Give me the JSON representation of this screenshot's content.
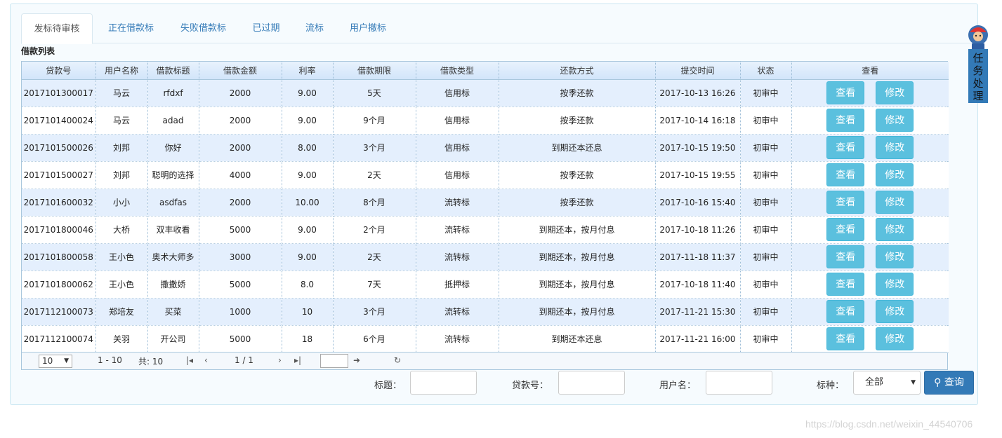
{
  "tabs": [
    {
      "label": "发标待审核",
      "active": true
    },
    {
      "label": "正在借款标"
    },
    {
      "label": "失败借款标"
    },
    {
      "label": "已过期"
    },
    {
      "label": "流标"
    },
    {
      "label": "用户撤标"
    }
  ],
  "list_title": "借款列表",
  "columns": [
    "贷款号",
    "用户名称",
    "借款标题",
    "借款金额",
    "利率",
    "借款期限",
    "借款类型",
    "还款方式",
    "提交时间",
    "状态",
    "查看"
  ],
  "rows": [
    [
      "2017101300017",
      "马云",
      "rfdxf",
      "2000",
      "9.00",
      "5天",
      "信用标",
      "按季还款",
      "2017-10-13 16:26",
      "初审中"
    ],
    [
      "2017101400024",
      "马云",
      "adad",
      "2000",
      "9.00",
      "9个月",
      "信用标",
      "按季还款",
      "2017-10-14 16:18",
      "初审中"
    ],
    [
      "2017101500026",
      "刘邦",
      "你好",
      "2000",
      "8.00",
      "3个月",
      "信用标",
      "到期还本还息",
      "2017-10-15 19:50",
      "初审中"
    ],
    [
      "2017101500027",
      "刘邦",
      "聪明的选择",
      "4000",
      "9.00",
      "2天",
      "信用标",
      "按季还款",
      "2017-10-15 19:55",
      "初审中"
    ],
    [
      "2017101600032",
      "小小",
      "asdfas",
      "2000",
      "10.00",
      "8个月",
      "流转标",
      "按季还款",
      "2017-10-16 15:40",
      "初审中"
    ],
    [
      "2017101800046",
      "大桥",
      "双丰收看",
      "5000",
      "9.00",
      "2个月",
      "流转标",
      "到期还本，按月付息",
      "2017-10-18 11:26",
      "初审中"
    ],
    [
      "2017101800058",
      "王小色",
      "奥术大师多",
      "3000",
      "9.00",
      "2天",
      "流转标",
      "到期还本，按月付息",
      "2017-11-18 11:37",
      "初审中"
    ],
    [
      "2017101800062",
      "王小色",
      "撒撒娇",
      "5000",
      "8.0",
      "7天",
      "抵押标",
      "到期还本，按月付息",
      "2017-10-18 11:40",
      "初审中"
    ],
    [
      "2017112100073",
      "郑培友",
      "买菜",
      "1000",
      "10",
      "3个月",
      "流转标",
      "到期还本，按月付息",
      "2017-11-21 15:30",
      "初审中"
    ],
    [
      "2017112100074",
      "关羽",
      "开公司",
      "5000",
      "18",
      "6个月",
      "流转标",
      "到期还本还息",
      "2017-11-21 16:00",
      "初审中"
    ]
  ],
  "row_actions": {
    "view": "查看",
    "edit": "修改"
  },
  "pager": {
    "page_size": "10",
    "range": "1 - 10",
    "total": "共: 10",
    "page": "1 / 1"
  },
  "filters": {
    "title_label": "标题：",
    "loan_no_label": "贷款号：",
    "username_label": "用户名：",
    "type_label": "标种：",
    "type_value": "全部",
    "search_label": "查询"
  },
  "side_task": "任务处理",
  "watermark": "https://blog.csdn.net/weixin_44540706"
}
